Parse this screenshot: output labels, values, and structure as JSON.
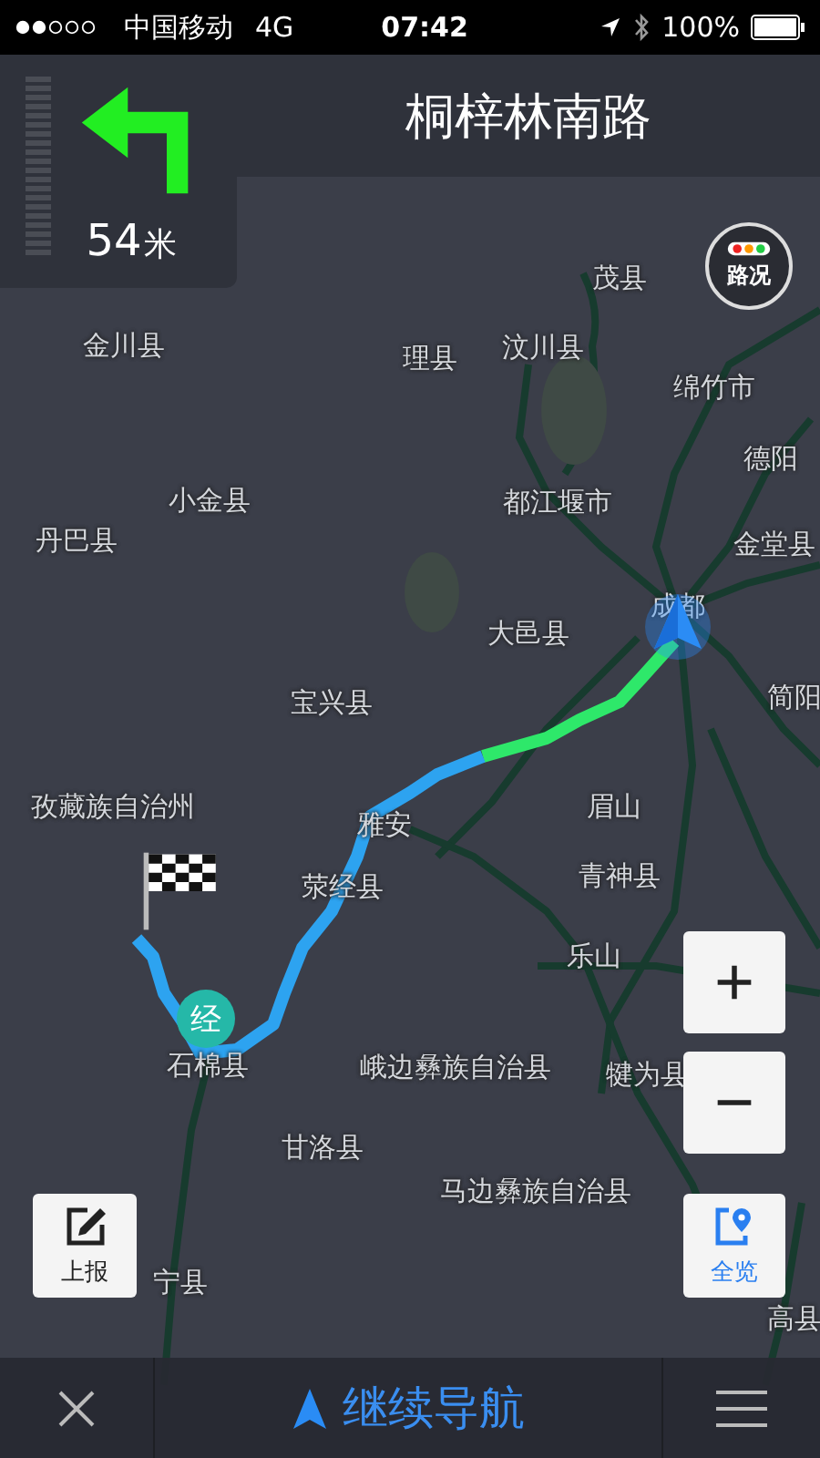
{
  "status_bar": {
    "carrier": "中国移动",
    "network": "4G",
    "time": "07:42",
    "battery": "100%"
  },
  "guidance": {
    "distance": "54",
    "unit": "米",
    "street": "桐梓林南路"
  },
  "traffic_button": {
    "label": "路况"
  },
  "map_labels": [
    "茂县",
    "金川县",
    "理县",
    "汶川县",
    "绵竹市",
    "德阳",
    "小金县",
    "丹巴县",
    "都江堰市",
    "金堂县",
    "成都",
    "大邑县",
    "宝兴县",
    "简阳",
    "孜藏族自治州",
    "雅安",
    "眉山",
    "荥经县",
    "青神县",
    "乐山",
    "石棉县",
    "峨边彝族自治县",
    "犍为县",
    "甘洛县",
    "马边彝族自治县",
    "宁县",
    "高县"
  ],
  "waypoint": {
    "label": "经"
  },
  "report_button": {
    "label": "上报"
  },
  "overview_button": {
    "label": "全览"
  },
  "bottom_bar": {
    "continue_label": "继续导航"
  }
}
